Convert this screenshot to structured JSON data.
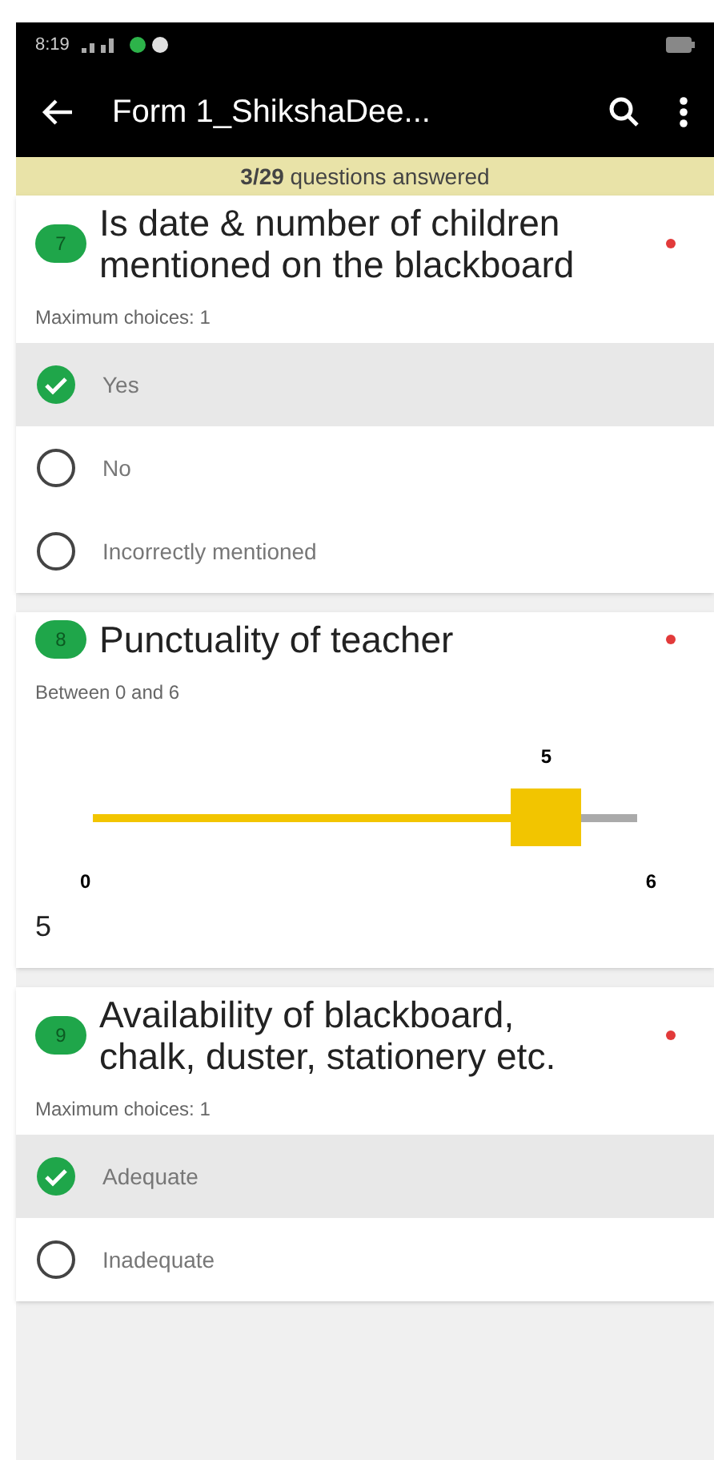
{
  "status_bar": {
    "time": "8:19"
  },
  "app_bar": {
    "title": "Form 1_ShikshaDee..."
  },
  "progress_banner": {
    "text": "**3/29** questions answered"
  },
  "questions": [
    {
      "kind": "choice",
      "number": "7",
      "title": "Is date & number of children mentioned on the blackboard",
      "required": true,
      "hint": "Maximum choices: 1",
      "options": [
        {
          "label": "Yes",
          "selected": true
        },
        {
          "label": "No",
          "selected": false
        },
        {
          "label": "Incorrectly mentioned",
          "selected": false
        }
      ]
    },
    {
      "kind": "slider",
      "number": "8",
      "title": "Punctuality of teacher",
      "required": true,
      "hint": "Between 0 and 6",
      "thumb_label": "5",
      "min_label": "0",
      "max_label": "6",
      "level": 0.833,
      "value": "5"
    },
    {
      "kind": "choice",
      "number": "9",
      "title": "Availability of blackboard, chalk, duster, stationery etc.",
      "required": true,
      "hint": "Maximum choices: 1",
      "options": [
        {
          "label": "Adequate",
          "selected": true
        },
        {
          "label": "Inadequate",
          "selected": false
        }
      ]
    }
  ]
}
